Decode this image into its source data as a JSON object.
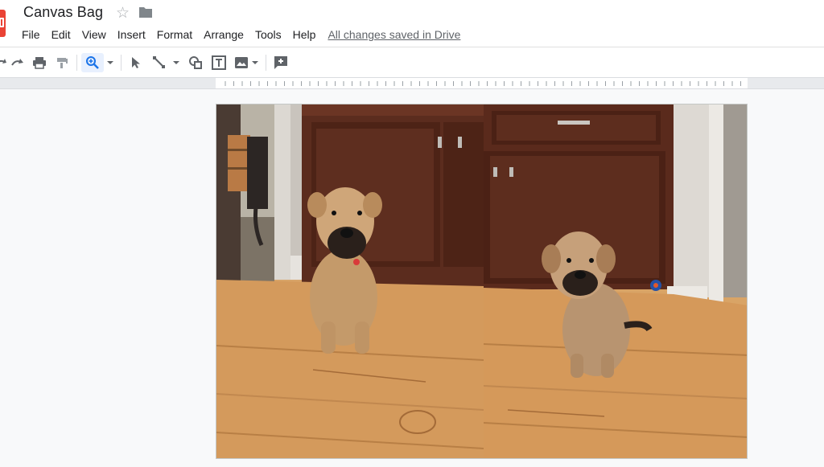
{
  "document": {
    "title": "Canvas Bag",
    "save_status": "All changes saved in Drive"
  },
  "menu": [
    {
      "label": "File"
    },
    {
      "label": "Edit"
    },
    {
      "label": "View"
    },
    {
      "label": "Insert"
    },
    {
      "label": "Format"
    },
    {
      "label": "Arrange"
    },
    {
      "label": "Tools"
    },
    {
      "label": "Help"
    }
  ],
  "toolbar": {
    "tools": [
      "undo-icon",
      "redo-icon",
      "print-icon",
      "paint-format-icon",
      "zoom-icon",
      "select-icon",
      "line-icon",
      "shape-icon",
      "text-box-icon",
      "image-icon",
      "add-comment-icon"
    ],
    "active_tool": "zoom"
  },
  "canvas": {
    "images": [
      {
        "name": "photo-dog-sitting-left"
      },
      {
        "name": "photo-dog-sitting-right"
      }
    ]
  },
  "colors": {
    "logo": "#ea4335",
    "active_tool_bg": "#e8f0fe",
    "zoom_icon": "#1a73e8"
  }
}
